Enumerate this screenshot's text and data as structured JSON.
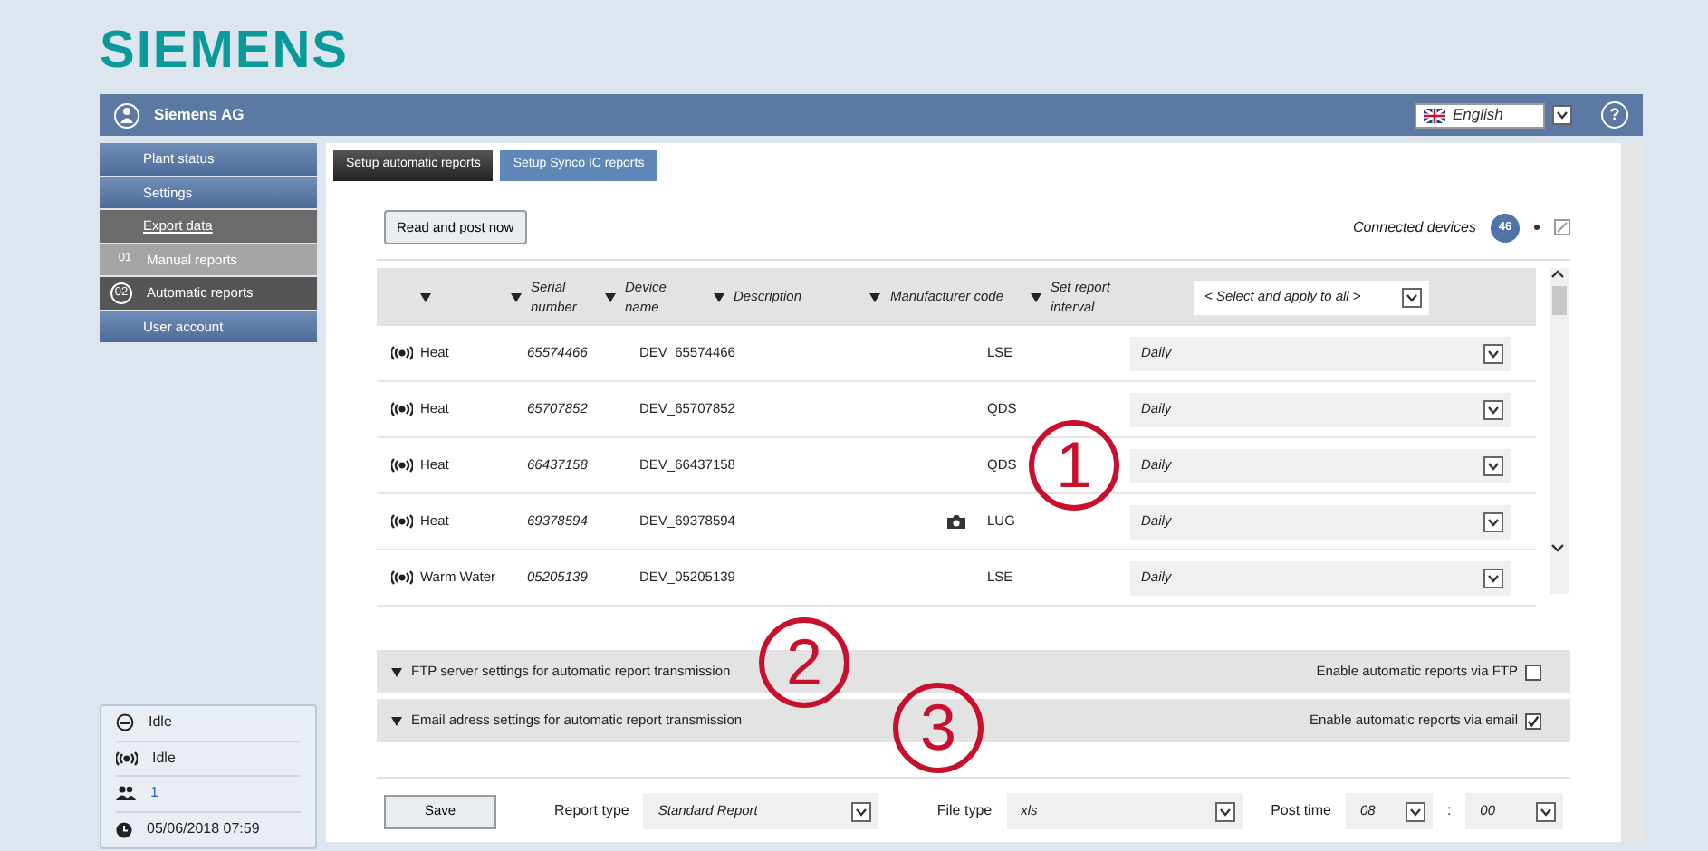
{
  "logo": "SIEMENS",
  "header": {
    "title": "Siemens AG",
    "language": "English",
    "help": "?"
  },
  "sidebar": {
    "items": [
      {
        "label": "Plant status",
        "kind": "main",
        "selected": false
      },
      {
        "label": "Settings",
        "kind": "main",
        "selected": false
      },
      {
        "label": "Export data",
        "kind": "group",
        "selected": false
      },
      {
        "label": "Manual reports",
        "prefix": "01",
        "kind": "sub",
        "selected": false
      },
      {
        "label": "Automatic reports",
        "prefix": "02",
        "kind": "sub",
        "selected": true
      },
      {
        "label": "User account",
        "kind": "main",
        "selected": false
      }
    ]
  },
  "status": [
    {
      "kind": "mode",
      "text": "Idle"
    },
    {
      "kind": "radio",
      "text": "Idle"
    },
    {
      "kind": "users",
      "text": "1"
    },
    {
      "kind": "clock",
      "text": "05/06/2018 07:59"
    }
  ],
  "tabs": [
    {
      "label": "Setup automatic reports",
      "selected": true
    },
    {
      "label": "Setup Synco IC reports",
      "selected": false
    }
  ],
  "read_button": "Read and post now",
  "connected": {
    "label": "Connected devices",
    "count": "46"
  },
  "table": {
    "columns": [
      "Serial number",
      "Device name",
      "Description",
      "Manufacturer code",
      "Set report interval"
    ],
    "apply_all": "< Select and apply to all >",
    "rows": [
      {
        "type": "Heat",
        "serial": "65574466",
        "device": "DEV_65574466",
        "camera": false,
        "manufacturer": "LSE",
        "interval": "Daily"
      },
      {
        "type": "Heat",
        "serial": "65707852",
        "device": "DEV_65707852",
        "camera": false,
        "manufacturer": "QDS",
        "interval": "Daily"
      },
      {
        "type": "Heat",
        "serial": "66437158",
        "device": "DEV_66437158",
        "camera": false,
        "manufacturer": "QDS",
        "interval": "Daily"
      },
      {
        "type": "Heat",
        "serial": "69378594",
        "device": "DEV_69378594",
        "camera": true,
        "manufacturer": "LUG",
        "interval": "Daily"
      },
      {
        "type": "Warm Water",
        "serial": "05205139",
        "device": "DEV_05205139",
        "camera": false,
        "manufacturer": "LSE",
        "interval": "Daily"
      }
    ]
  },
  "sections": [
    {
      "title": "FTP server settings for automatic report transmission",
      "option": "Enable automatic reports via FTP",
      "checked": false
    },
    {
      "title": "Email adress settings for automatic report transmission",
      "option": "Enable automatic reports via email",
      "checked": true
    }
  ],
  "footer": {
    "save": "Save",
    "report_type_label": "Report type",
    "report_type": "Standard Report",
    "file_type_label": "File type",
    "file_type": "xls",
    "post_time_label": "Post time",
    "hour": "08",
    "separator": ":",
    "minute": "00"
  },
  "callouts": [
    "1",
    "2",
    "3"
  ]
}
